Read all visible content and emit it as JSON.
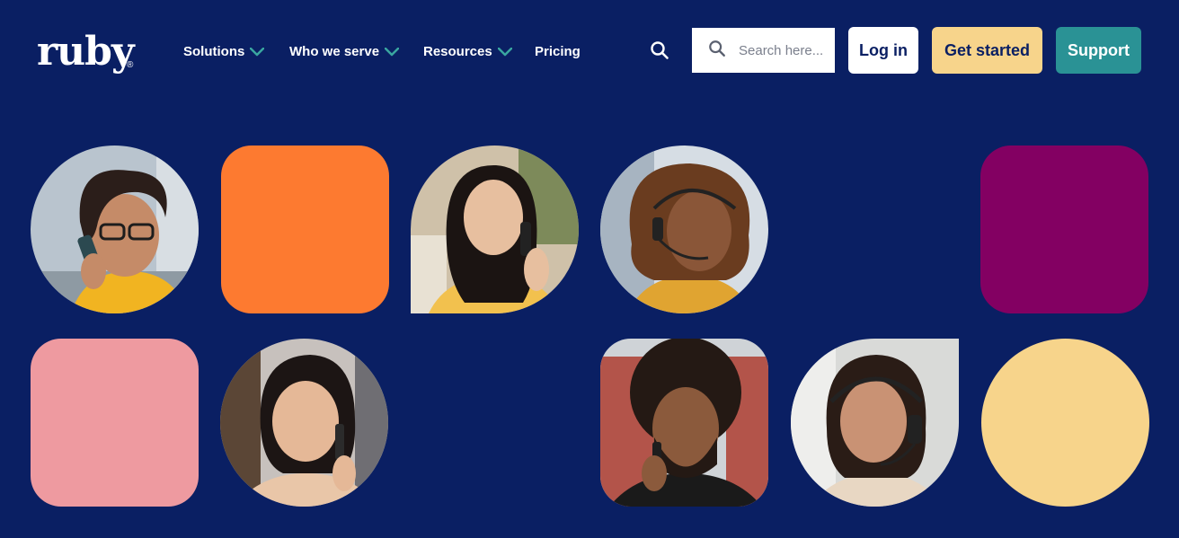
{
  "brand": {
    "name": "ruby",
    "registered": "®"
  },
  "nav": [
    {
      "label": "Solutions",
      "has_dropdown": true
    },
    {
      "label": "Who we serve",
      "has_dropdown": true
    },
    {
      "label": "Resources",
      "has_dropdown": true
    },
    {
      "label": "Pricing",
      "has_dropdown": false
    }
  ],
  "search": {
    "placeholder": "Search here..."
  },
  "actions": {
    "login_label": "Log in",
    "get_started_label": "Get started",
    "support_label": "Support"
  },
  "colors": {
    "background": "#0a1f63",
    "chevron": "#3aa6a0",
    "orange": "#fd7a30",
    "magenta": "#830062",
    "pink": "#ee9aa0",
    "yellow": "#f7d48b",
    "teal": "#2a9295"
  },
  "tiles": [
    {
      "kind": "photo",
      "shape": "circle",
      "subject": "woman with glasses on phone"
    },
    {
      "kind": "color",
      "shape": "rounded-square",
      "color": "orange"
    },
    {
      "kind": "photo",
      "shape": "circle-flat-bottom",
      "subject": "woman smiling on phone"
    },
    {
      "kind": "photo",
      "shape": "circle",
      "subject": "woman with headset"
    },
    {
      "kind": "color",
      "shape": "rounded-square",
      "color": "magenta"
    },
    {
      "kind": "color",
      "shape": "rounded-square",
      "color": "pink"
    },
    {
      "kind": "photo",
      "shape": "circle",
      "subject": "woman smiling on phone"
    },
    {
      "kind": "photo",
      "shape": "rounded-square",
      "subject": "man with curly hair on phone"
    },
    {
      "kind": "photo",
      "shape": "circle-flat-corner",
      "subject": "woman with headset"
    },
    {
      "kind": "color",
      "shape": "circle",
      "color": "yellow"
    }
  ]
}
